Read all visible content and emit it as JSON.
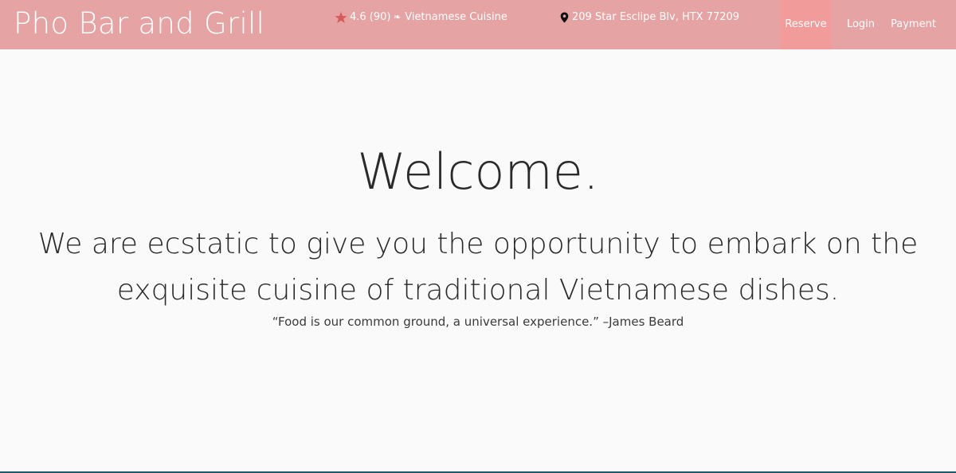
{
  "header": {
    "brand": "Pho Bar and Grill",
    "rating": "4.6 (90)",
    "cuisine": "Vietnamese Cuisine",
    "address": "209 Star Esclipe Blv, HTX 77209",
    "nav": {
      "reserve": "Reserve",
      "login": "Login",
      "payment": "Payment"
    }
  },
  "hero": {
    "title": "Welcome.",
    "subtitle": "We are ecstatic to give you the opportunity to embark on the exquisite cuisine of traditional Vietnamese dishes.",
    "quote": "“Food is our common ground, a universal experience.” –James Beard"
  },
  "colors": {
    "header_bg": "#e6a3a3",
    "nav_active_bg": "#f29b9b",
    "star": "#d65c5c",
    "text": "#2a2a2a",
    "bottom_line": "#1f5a6b"
  },
  "icons": {
    "rating": "star-icon",
    "cuisine": "leaf-icon",
    "address": "map-pin-icon"
  }
}
